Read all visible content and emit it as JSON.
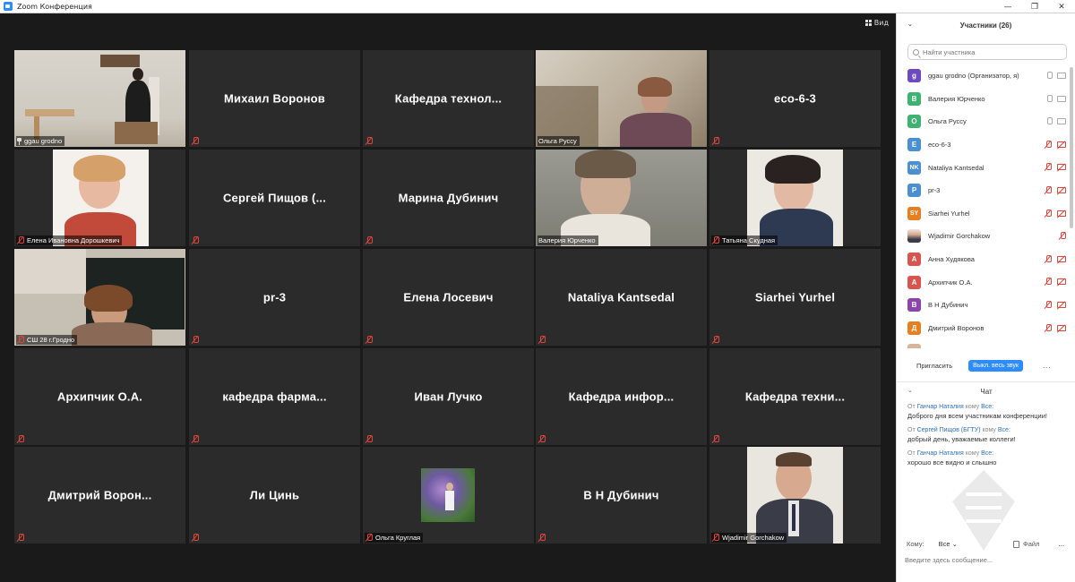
{
  "window": {
    "title": "Zoom Конференция",
    "minimize": "—",
    "maximize": "❐",
    "close": "✕"
  },
  "view_button": {
    "label": "Вид"
  },
  "tiles": [
    {
      "label": "ggau grodno",
      "show_big": false
    },
    {
      "label": "Михаил Воронов"
    },
    {
      "label": "Кафедра  технол..."
    },
    {
      "label": "Ольга Руссу"
    },
    {
      "label": "eco-6-3"
    },
    {
      "label": "Елена Ивановна Дорошкевич"
    },
    {
      "label": "Сергей Пищов  (..."
    },
    {
      "label": "Марина Дубинич"
    },
    {
      "label": "Валерия Юрченко"
    },
    {
      "label": "Татьяна Скудная"
    },
    {
      "label": "СШ 28 г.Гродно"
    },
    {
      "label": "pr-3"
    },
    {
      "label": "Елена Лосевич"
    },
    {
      "label": "Nataliya Kantsedal"
    },
    {
      "label": "Siarhei Yurhel"
    },
    {
      "label": "Архипчик О.А."
    },
    {
      "label": "кафедра  фарма..."
    },
    {
      "label": "Иван Лучко"
    },
    {
      "label": "Кафедра  инфор..."
    },
    {
      "label": "Кафедра  техни..."
    },
    {
      "label": "Дмитрий  Ворон..."
    },
    {
      "label": "Ли Цинь"
    },
    {
      "label": "Ольга Круглая"
    },
    {
      "label": "В Н Дубинич"
    },
    {
      "label": "Wjadimir Gorchakow"
    }
  ],
  "participants_panel": {
    "title": "Участники (26)",
    "search_placeholder": "Найти участника",
    "participants": [
      {
        "initials": "g",
        "color": "#6b4bbf",
        "name": "ggau grodno (Организатор, я)"
      },
      {
        "initials": "В",
        "color": "#3cb371",
        "name": "Валерия Юрченко"
      },
      {
        "initials": "О",
        "color": "#3cb371",
        "name": "Ольга Руссу"
      },
      {
        "initials": "E",
        "color": "#4a8fd1",
        "name": "eco-6-3"
      },
      {
        "initials": "NK",
        "color": "#4a8fd1",
        "name": "Nataliya Kantsedal"
      },
      {
        "initials": "P",
        "color": "#4a8fd1",
        "name": "pr-3"
      },
      {
        "initials": "SY",
        "color": "#e67e22",
        "name": "Siarhei Yurhel"
      },
      {
        "initials": "",
        "color": "#ffffff",
        "name": "Wjadimir Gorchakow"
      },
      {
        "initials": "А",
        "color": "#d9534f",
        "name": "Анна Худякова"
      },
      {
        "initials": "А",
        "color": "#d9534f",
        "name": "Архипчик О.А."
      },
      {
        "initials": "В",
        "color": "#8e44ad",
        "name": "В Н Дубинич"
      },
      {
        "initials": "Д",
        "color": "#e67e22",
        "name": "Дмитрий Воронов"
      }
    ],
    "invite_label": "Пригласить",
    "mute_all_label": "Выкл. весь звук",
    "more_label": "..."
  },
  "chat": {
    "title": "Чат",
    "from_label": "От",
    "to_label": "кому",
    "messages": [
      {
        "sender": "Ганчар Наталия",
        "recipient": "Все:",
        "text": "Доброго дня всем участникам конференции!"
      },
      {
        "sender": "Сергей Пищов (БГТУ)",
        "recipient": "Все:",
        "text": "добрый день, уважаемые коллеги!"
      },
      {
        "sender": "Ганчар Наталия",
        "recipient": "Все:",
        "text": "хорошо все видно и слышно"
      }
    ],
    "recipient_label": "Кому:",
    "recipient_value": "Все",
    "file_label": "Файл",
    "more_label": "...",
    "input_placeholder": "Введите здесь сообщение..."
  }
}
